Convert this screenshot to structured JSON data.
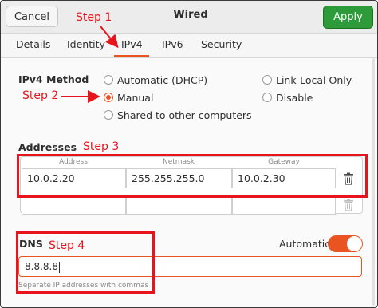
{
  "header": {
    "cancel_label": "Cancel",
    "title": "Wired",
    "apply_label": "Apply"
  },
  "tabs": [
    {
      "label": "Details"
    },
    {
      "label": "Identity"
    },
    {
      "label": "IPv4"
    },
    {
      "label": "IPv6"
    },
    {
      "label": "Security"
    }
  ],
  "active_tab": "IPv4",
  "method": {
    "label": "IPv4 Method",
    "options": [
      {
        "label": "Automatic (DHCP)",
        "checked": false
      },
      {
        "label": "Manual",
        "checked": true
      },
      {
        "label": "Shared to other computers",
        "checked": false
      },
      {
        "label": "Link-Local Only",
        "checked": false
      },
      {
        "label": "Disable",
        "checked": false
      }
    ]
  },
  "addresses": {
    "label": "Addresses",
    "columns": [
      "Address",
      "Netmask",
      "Gateway"
    ],
    "rows": [
      {
        "address": "10.0.2.20",
        "netmask": "255.255.255.0",
        "gateway": "10.0.2.30"
      },
      {
        "address": "",
        "netmask": "",
        "gateway": ""
      }
    ]
  },
  "dns": {
    "label": "DNS",
    "automatic_label": "Automatic",
    "automatic_on": true,
    "value": "8.8.8.8",
    "hint": "Separate IP addresses with commas"
  },
  "annotations": {
    "step1": "Step 1",
    "step2": "Step 2",
    "step3": "Step 3",
    "step4": "Step 4"
  },
  "colors": {
    "accent": "#e95420",
    "apply": "#2e9b3b",
    "annotation": "#e8141c"
  },
  "icons": {
    "delete": "trash-icon"
  }
}
